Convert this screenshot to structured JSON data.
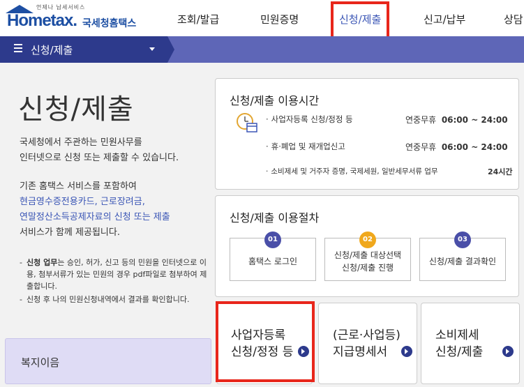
{
  "header": {
    "logo_tagline": "언제나 납세서비스",
    "logo_brand": "Hometax.",
    "logo_sub": "국세청홈택스",
    "nav": [
      "조회/발급",
      "민원증명",
      "신청/제출",
      "신고/납부",
      "상담"
    ]
  },
  "breadcrumb": {
    "label": "신청/제출"
  },
  "intro": {
    "title": "신청/제출",
    "para1": [
      "국세청에서 주관하는 민원사무를",
      "인터넷으로 신청 또는 제출할 수 있습니다."
    ],
    "para2_line1": "기존 홈택스 서비스를 포함하여",
    "para2_link1": "현금영수증전용카드, 근로장려금,",
    "para2_link2": "연말정산소득공제자료의 신청 또는 제출",
    "para2_line4": "서비스가 함께 제공됩니다.",
    "note1_bold": "신청 업무",
    "note1_text": "는 승인, 허가, 신고 등의 민원을 인터넷으로 이용, 첨부서류가 있는 민원의 경우 pdf파일로 첨부하여 제출합니다.",
    "note2_text": "신청 후 나의 민원신청내역에서 결과를 확인합니다.",
    "dash": "-"
  },
  "welfare": {
    "label": "복지이음"
  },
  "usage_time": {
    "title": "신청/제출 이용시간",
    "bullet": "·",
    "rows": [
      {
        "label": "사업자등록 신청/정정 등",
        "days": "연중무휴",
        "hours": "06:00 ~ 24:00"
      },
      {
        "label": "휴·폐업 및 재개업신고",
        "days": "연중무휴",
        "hours": "06:00 ~ 24:00"
      },
      {
        "label": "소비제세 및 거주자 증명, 국제세원, 일반세무서류 업무",
        "days": "",
        "hours": "24시간"
      }
    ]
  },
  "procedure": {
    "title": "신청/제출 이용절차",
    "steps": [
      {
        "num": "01",
        "line1": "홈택스 로그인",
        "line2": "",
        "color": "#4a4fa8"
      },
      {
        "num": "02",
        "line1": "신청/제출 대상선택",
        "line2": "신청/제출 진행",
        "color": "#f0a81c"
      },
      {
        "num": "03",
        "line1": "신청/제출 결과확인",
        "line2": "",
        "color": "#4a4fa8"
      }
    ]
  },
  "quick_cards": [
    {
      "line1": "사업자등록",
      "line2": "신청/정정 등"
    },
    {
      "line1": "(근로·사업등)",
      "line2": "지급명세서"
    },
    {
      "line1": "소비제세",
      "line2": "신청/제출"
    }
  ],
  "colors": {
    "accent_red": "#e8261b",
    "nav_blue": "#5e66b7",
    "crumb_navy": "#2d3a8c"
  }
}
